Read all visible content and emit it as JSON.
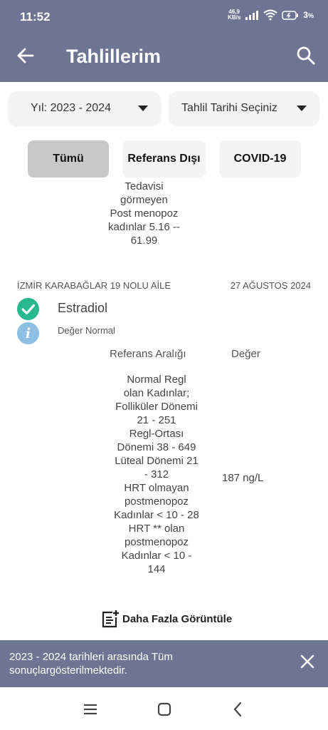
{
  "status_bar": {
    "time": "11:52",
    "speed_value": "46,9",
    "speed_unit": "KB/s",
    "battery_percent": "3",
    "battery_unit": "%"
  },
  "app_bar": {
    "title": "Tahlillerim"
  },
  "filters": {
    "year_select": "Yıl: 2023 - 2024",
    "date_select": "Tahlil Tarihi Seçiniz"
  },
  "tabs": [
    {
      "label": "Tümü",
      "active": true
    },
    {
      "label": "Referans Dışı",
      "active": false
    },
    {
      "label": "COVID-19",
      "active": false
    }
  ],
  "previous_reference_lines": [
    "Tedavisi",
    "görmeyen",
    "Post menopoz",
    "kadınlar 5.16 --",
    "61.99"
  ],
  "result": {
    "lab_name": "İZMİR KARABAĞLAR 19 NOLU AİLE",
    "date": "27 AĞUSTOS 2024",
    "test_name": "Estradiol",
    "status": "Değer Normal",
    "reference_header": "Referans Aralığı",
    "value_header": "Değer",
    "reference_lines": [
      "Normal Regl",
      "olan Kadınlar;",
      "Folliküler Dönemi",
      "21 - 251",
      "Regl-Ortası",
      "Dönemi 38 - 649",
      "Lüteal Dönemi 21",
      "- 312",
      "HRT olmayan",
      "postmenopoz",
      "Kadınlar < 10 - 28",
      "HRT ** olan",
      "postmenopoz",
      "Kadınlar < 10 -",
      "144"
    ],
    "value": "187  ng/L"
  },
  "more_button": "Daha Fazla Görüntüle",
  "snackbar": {
    "message": "2023 - 2024 tarihleri arasında Tüm sonuçlargösterilmektedir."
  },
  "colors": {
    "header": "#6d7593",
    "check_green": "#27b88d",
    "info_blue": "#8dbfe3",
    "active_tab": "#c8c8c8"
  }
}
